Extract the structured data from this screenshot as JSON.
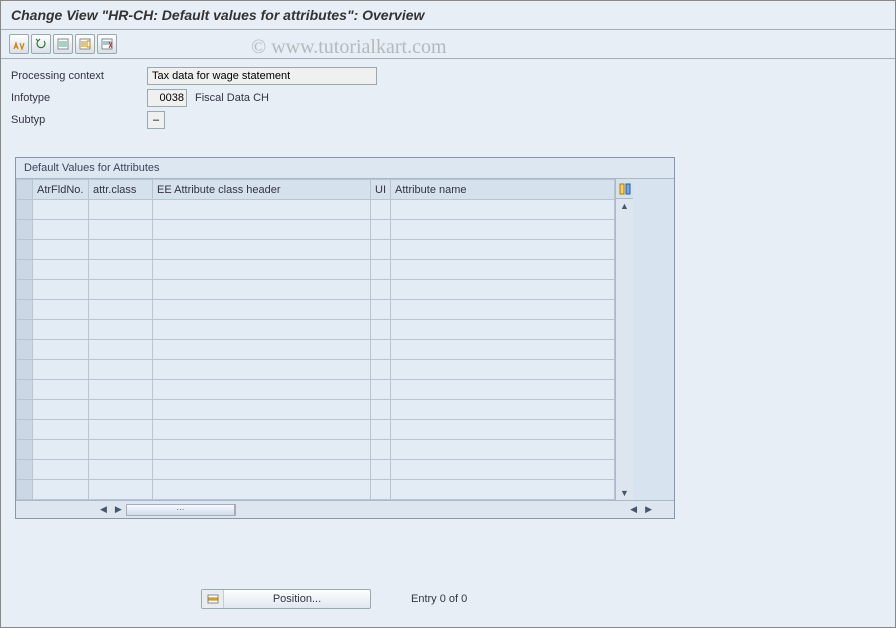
{
  "title": "Change View \"HR-CH: Default values for attributes\": Overview",
  "watermark": "© www.tutorialkart.com",
  "form": {
    "processing_context_label": "Processing context",
    "processing_context_value": "Tax data for wage statement",
    "infotype_label": "Infotype",
    "infotype_code": "0038",
    "infotype_text": "Fiscal Data  CH",
    "subtyp_label": "Subtyp",
    "subtyp_value": "–"
  },
  "table": {
    "caption": "Default Values for Attributes",
    "columns": {
      "atr": "AtrFldNo.",
      "class": "attr.class",
      "ee": "EE Attribute class header",
      "ui": "UI",
      "name": "Attribute name"
    }
  },
  "footer": {
    "position_label": "Position...",
    "entry_text": "Entry 0 of 0"
  }
}
